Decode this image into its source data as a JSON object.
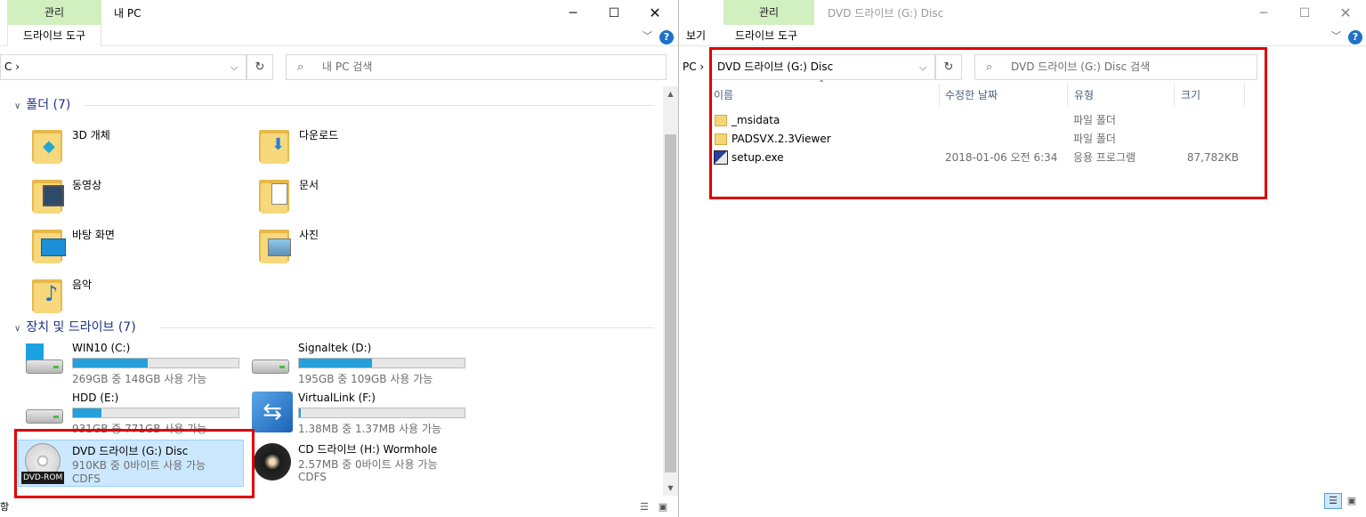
{
  "left": {
    "ctx_tab": "관리",
    "title": "내 PC",
    "ribbon": {
      "drive_tools": "드라이브 도구"
    },
    "address": "C ›",
    "search_placeholder": "내 PC 검색",
    "folders_header": "폴더 (7)",
    "folders": [
      {
        "name": "3D 개체",
        "icon": "3d-objects-icon"
      },
      {
        "name": "다운로드",
        "icon": "downloads-icon"
      },
      {
        "name": "동영상",
        "icon": "videos-icon"
      },
      {
        "name": "문서",
        "icon": "documents-icon"
      },
      {
        "name": "바탕 화면",
        "icon": "desktop-icon"
      },
      {
        "name": "사진",
        "icon": "pictures-icon"
      },
      {
        "name": "음악",
        "icon": "music-icon"
      }
    ],
    "drives_header": "장치 및 드라이브 (7)",
    "drives": [
      {
        "name": "WIN10 (C:)",
        "info": "269GB 중 148GB 사용 가능",
        "used_fraction": 0.45
      },
      {
        "name": "Signaltek (D:)",
        "info": "195GB 중 109GB 사용 가능",
        "used_fraction": 0.44
      },
      {
        "name": "HDD (E:)",
        "info": "931GB 중 771GB 사용 가능",
        "used_fraction": 0.17
      },
      {
        "name": "VirtualLink (F:)",
        "info": "1.38MB 중 1.37MB 사용 가능",
        "used_fraction": 0.01
      },
      {
        "name": "DVD 드라이브 (G:) Disc",
        "info": "910KB 중 0바이트 사용 가능",
        "fs": "CDFS",
        "badge": "DVD-ROM"
      },
      {
        "name": "CD 드라이브 (H:) Wormhole",
        "info": "2.57MB 중 0바이트 사용 가능",
        "fs": "CDFS"
      }
    ],
    "status_partial": "항"
  },
  "right": {
    "ctx_tab": "관리",
    "title": "DVD 드라이브 (G:) Disc",
    "ribbon": {
      "view": "보기",
      "drive_tools": "드라이브 도구"
    },
    "address_prefix": "PC ›",
    "address": "DVD 드라이브 (G:) Disc",
    "search_placeholder": "DVD 드라이브 (G:) Disc 검색",
    "columns": {
      "name": "이름",
      "date": "수정한 날짜",
      "type": "유형",
      "size": "크기"
    },
    "files": [
      {
        "name": "_msidata",
        "date": "",
        "type": "파일 폴더",
        "size": "",
        "icon": "folder-icon"
      },
      {
        "name": "PADSVX.2.3Viewer",
        "date": "",
        "type": "파일 폴더",
        "size": "",
        "icon": "folder-icon"
      },
      {
        "name": "setup.exe",
        "date": "2018-01-06 오전 6:34",
        "type": "응용 프로그램",
        "size": "87,782KB",
        "icon": "setup-exe-icon"
      }
    ]
  },
  "colors": {
    "accent": "#26a0da",
    "highlight_box": "#e00000",
    "ctx_tab": "#d2efc0",
    "selection": "#cce8ff"
  }
}
